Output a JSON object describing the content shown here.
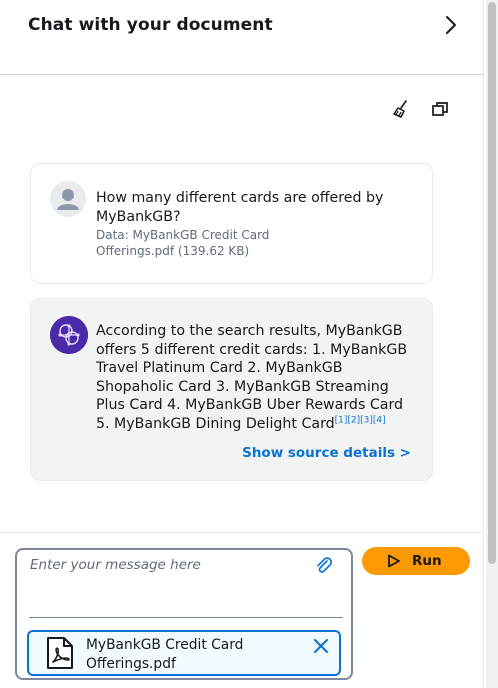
{
  "header": {
    "title": "Chat with your document",
    "chevron_icon": "chevron-right-icon"
  },
  "toolbar": {
    "clear_icon": "broom-icon",
    "copy_icon": "copy-icon"
  },
  "messages": [
    {
      "role": "user",
      "avatar_icon": "user-avatar-icon",
      "text": "How many different cards are offered by MyBankGB?",
      "meta_line1": "Data: MyBankGB Credit Card",
      "meta_line2": "Offerings.pdf (139.62 KB)"
    },
    {
      "role": "assistant",
      "avatar_icon": "ai-brain-icon",
      "text": "According to the search results, MyBankGB offers 5 different credit cards: 1. MyBankGB Travel Platinum Card 2. MyBankGB Shopaholic Card 3. MyBankGB Streaming Plus Card 4. MyBankGB Uber Rewards Card 5. MyBankGB Dining Delight Card",
      "citations": [
        "[1]",
        "[2]",
        "[3]",
        "[4]"
      ],
      "source_link": "Show source details >"
    }
  ],
  "composer": {
    "placeholder": "Enter your message here",
    "attach_icon": "paperclip-icon",
    "file_line1": "MyBankGB Credit Card",
    "file_line2": "Offerings.pdf",
    "file_icon": "pdf-file-icon",
    "remove_icon": "close-icon",
    "run_label": "Run",
    "run_icon": "play-icon"
  },
  "colors": {
    "accent": "#ff9900",
    "link": "#0972d3",
    "bot_avatar": "#4a2aa8",
    "bot_card_bg": "#f2f3f3"
  }
}
